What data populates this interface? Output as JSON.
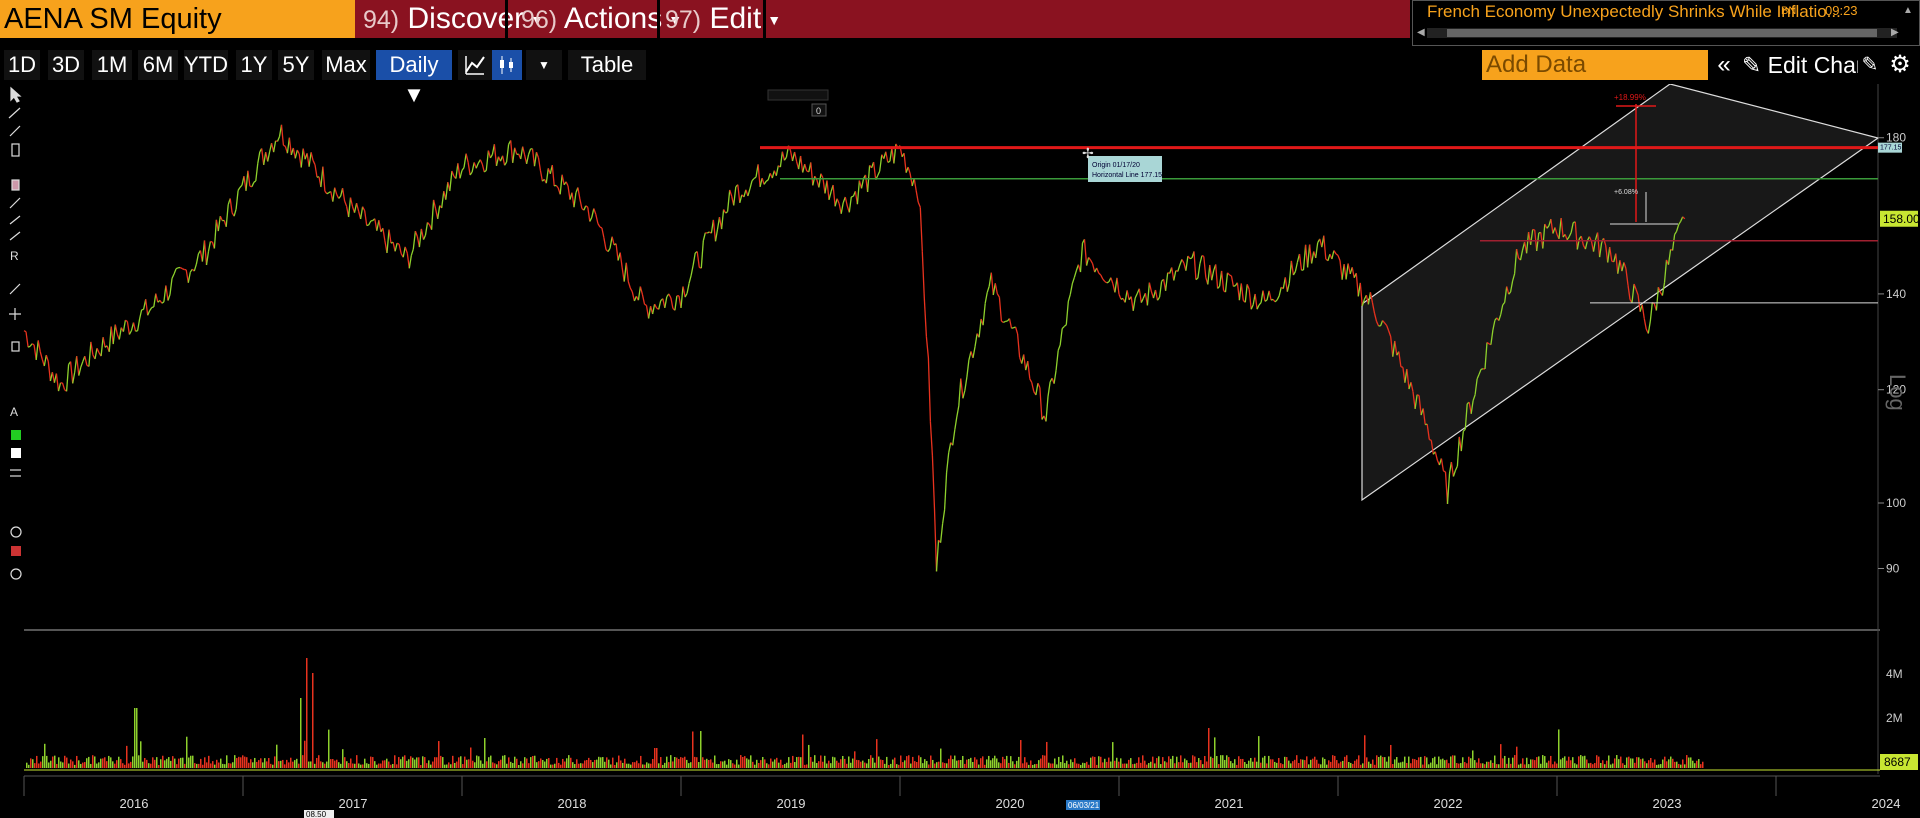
{
  "header": {
    "ticker": "AENA SM Equity",
    "menus": [
      {
        "num": "94)",
        "label": "Discover"
      },
      {
        "num": "96)",
        "label": "Actions"
      },
      {
        "num": "97)",
        "label": "Edit"
      }
    ]
  },
  "news": {
    "headline": "French Economy Unexpectedly Shrinks While Inflatio...",
    "source": "BN",
    "time": "09:23"
  },
  "toolbar": {
    "periods": [
      "1D",
      "3D",
      "1M",
      "6M",
      "YTD",
      "1Y",
      "5Y",
      "Max"
    ],
    "frequency": "Daily ▼",
    "table_label": "Table",
    "add_data_placeholder": "Add Data",
    "edit_chart_label": "Edit Chart"
  },
  "annotations": {
    "origin_line1": "Origin 01/17/20",
    "origin_line2": "Horizontal Line 177.15",
    "pct_up": "+18.99%",
    "pct_small": "+6.08%",
    "last_price_label": "158.00",
    "hline_label": "177.15",
    "volume_last_label": "8687",
    "bottom_marker_1": "08.50",
    "bottom_marker_2": "06/03/21",
    "log_label": "Log"
  },
  "colors": {
    "accent_orange": "#f7a21c",
    "menu_red": "#8a1220",
    "active_blue": "#1a4fa8",
    "price_up": "#8ed12c",
    "price_down": "#e8321e",
    "hline_red": "#e01818",
    "hline_green": "#3a9a3a",
    "last_price_bg": "#c8e632"
  },
  "chart_data": {
    "type": "line",
    "title": "",
    "scale": "log",
    "ylim": [
      85,
      195
    ],
    "yticks": [
      90,
      100,
      120,
      140,
      158,
      180
    ],
    "xlabels": [
      "2016",
      "2017",
      "2018",
      "2019",
      "2020",
      "2021",
      "2022",
      "2023",
      "2024"
    ],
    "series": [
      {
        "values_by_date": [
          [
            "2016-01",
            132
          ],
          [
            "2016-03",
            121
          ],
          [
            "2016-05",
            128
          ],
          [
            "2016-08",
            137
          ],
          [
            "2016-11",
            150
          ],
          [
            "2017-03",
            182
          ],
          [
            "2017-07",
            160
          ],
          [
            "2017-10",
            148
          ],
          [
            "2018-01",
            172
          ],
          [
            "2018-04",
            177
          ],
          [
            "2018-08",
            160
          ],
          [
            "2018-11",
            137
          ],
          [
            "2019-01",
            140
          ],
          [
            "2019-04",
            165
          ],
          [
            "2019-07",
            175
          ],
          [
            "2019-10",
            162
          ],
          [
            "2020-01",
            177
          ],
          [
            "2020-02",
            166
          ],
          [
            "2020-03",
            90
          ],
          [
            "2020-04",
            115
          ],
          [
            "2020-06",
            142
          ],
          [
            "2020-09",
            115
          ],
          [
            "2020-11",
            150
          ],
          [
            "2021-02",
            138
          ],
          [
            "2021-05",
            147
          ],
          [
            "2021-09",
            138
          ],
          [
            "2021-12",
            152
          ],
          [
            "2022-03",
            137
          ],
          [
            "2022-06",
            112
          ],
          [
            "2022-07",
            102
          ],
          [
            "2022-11",
            150
          ],
          [
            "2023-01",
            156
          ],
          [
            "2023-04",
            150
          ],
          [
            "2023-06",
            133
          ],
          [
            "2023-08",
            158
          ]
        ]
      }
    ],
    "volume": {
      "yticks": [
        "2M",
        "4M"
      ],
      "last": "8687"
    },
    "horizontal_lines": [
      177.15,
      168.5,
      152.5,
      138
    ],
    "grid": false,
    "legend": "none"
  }
}
